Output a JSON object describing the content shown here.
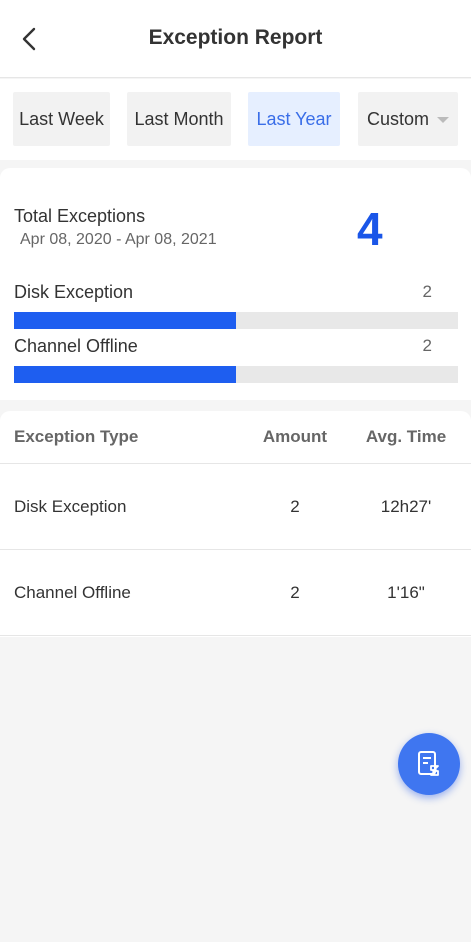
{
  "header": {
    "title": "Exception Report",
    "back_icon": "chevron-left-icon"
  },
  "filters": {
    "tabs": [
      "Last Week",
      "Last Month",
      "Last Year"
    ],
    "active": "Last Year",
    "custom_label": "Custom"
  },
  "summary": {
    "total_label": "Total Exceptions",
    "range": "Apr 08, 2020 - Apr 08, 2021",
    "total": "4",
    "accent_color": "#1e5ef0",
    "bars": [
      {
        "label": "Disk Exception",
        "count": "2",
        "fraction": 0.5
      },
      {
        "label": "Channel Offline",
        "count": "2",
        "fraction": 0.5
      }
    ]
  },
  "table": {
    "headers": [
      "Exception Type",
      "Amount",
      "Avg. Time"
    ],
    "rows": [
      {
        "type": "Disk Exception",
        "amount": "2",
        "avg_time": "12h27'"
      },
      {
        "type": "Channel Offline",
        "amount": "2",
        "avg_time": "1'16\""
      }
    ]
  },
  "fab": {
    "icon": "report-document-icon"
  }
}
